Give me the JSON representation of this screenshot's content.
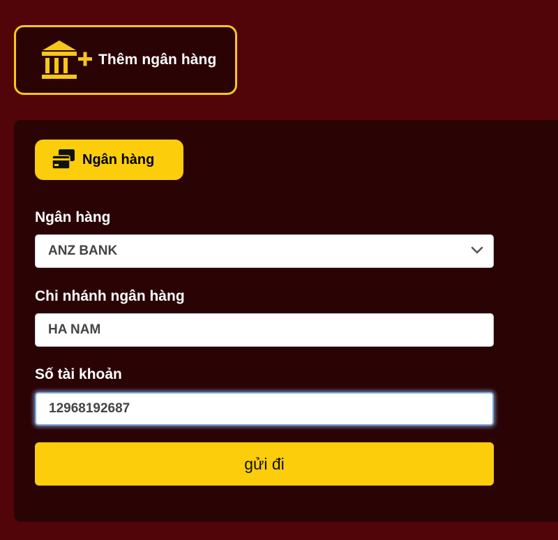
{
  "add_bank": {
    "label": "Thêm ngân hàng",
    "icon": "bank-plus-icon"
  },
  "tab": {
    "label": "Ngân hàng",
    "icon": "credit-card-icon"
  },
  "form": {
    "bank": {
      "label": "Ngân hàng",
      "value": "ANZ BANK"
    },
    "branch": {
      "label": "Chi nhánh ngân hàng",
      "value": "HA NAM"
    },
    "account": {
      "label": "Số tài khoản",
      "value": "12968192687"
    },
    "submit_label": "gửi đi"
  },
  "colors": {
    "page_background": "#520508",
    "panel_background": "#2a0305",
    "accent_yellow": "#fccd0a",
    "border_yellow": "#f7c718",
    "focus_ring": "#7da7d9"
  }
}
